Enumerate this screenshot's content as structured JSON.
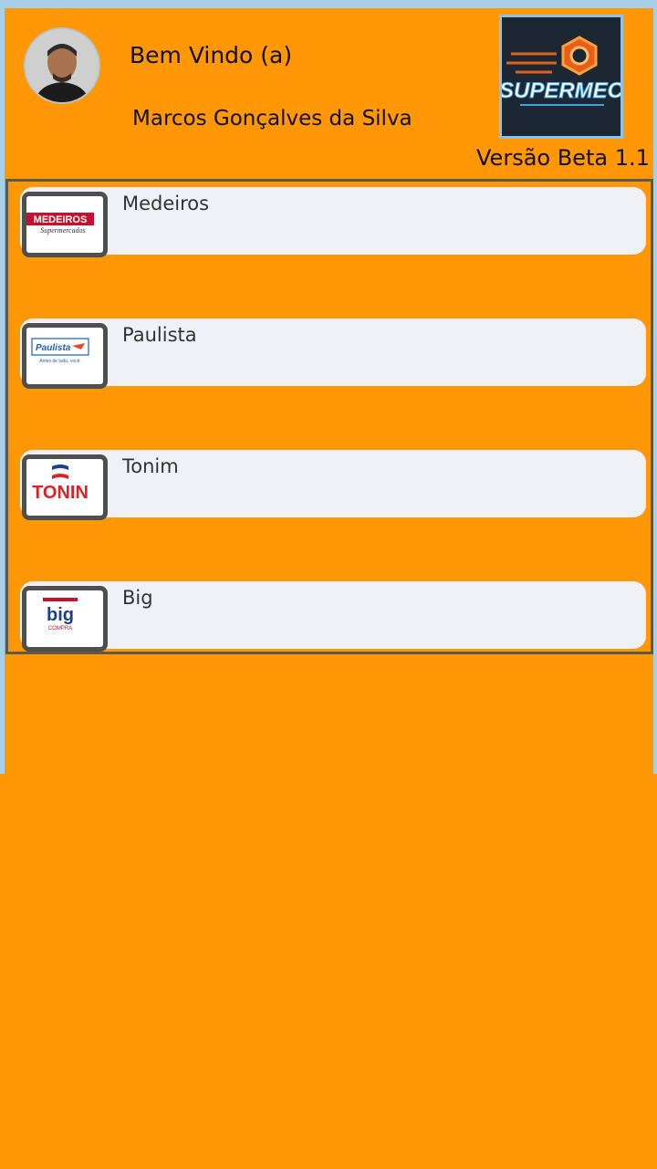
{
  "header": {
    "welcome": "Bem Vindo (a)",
    "user_name": "Marcos Gonçalves da Silva",
    "version": "Versão Beta 1.1",
    "logo_text": "SUPERMEC"
  },
  "stores": [
    {
      "name": "Medeiros",
      "logo_text": "MEDEIROS",
      "logo_subtext": "Supermercados"
    },
    {
      "name": "Paulista",
      "logo_text": "Paulista",
      "logo_subtext": "Antes de tudo, você."
    },
    {
      "name": "Tonim",
      "logo_text": "TONIN"
    },
    {
      "name": "Big",
      "logo_text": "big",
      "logo_subtext": "COMPRA"
    }
  ],
  "colors": {
    "background": "#FF9707",
    "card": "#EFF1F6",
    "frame": "#A5D0E8"
  }
}
